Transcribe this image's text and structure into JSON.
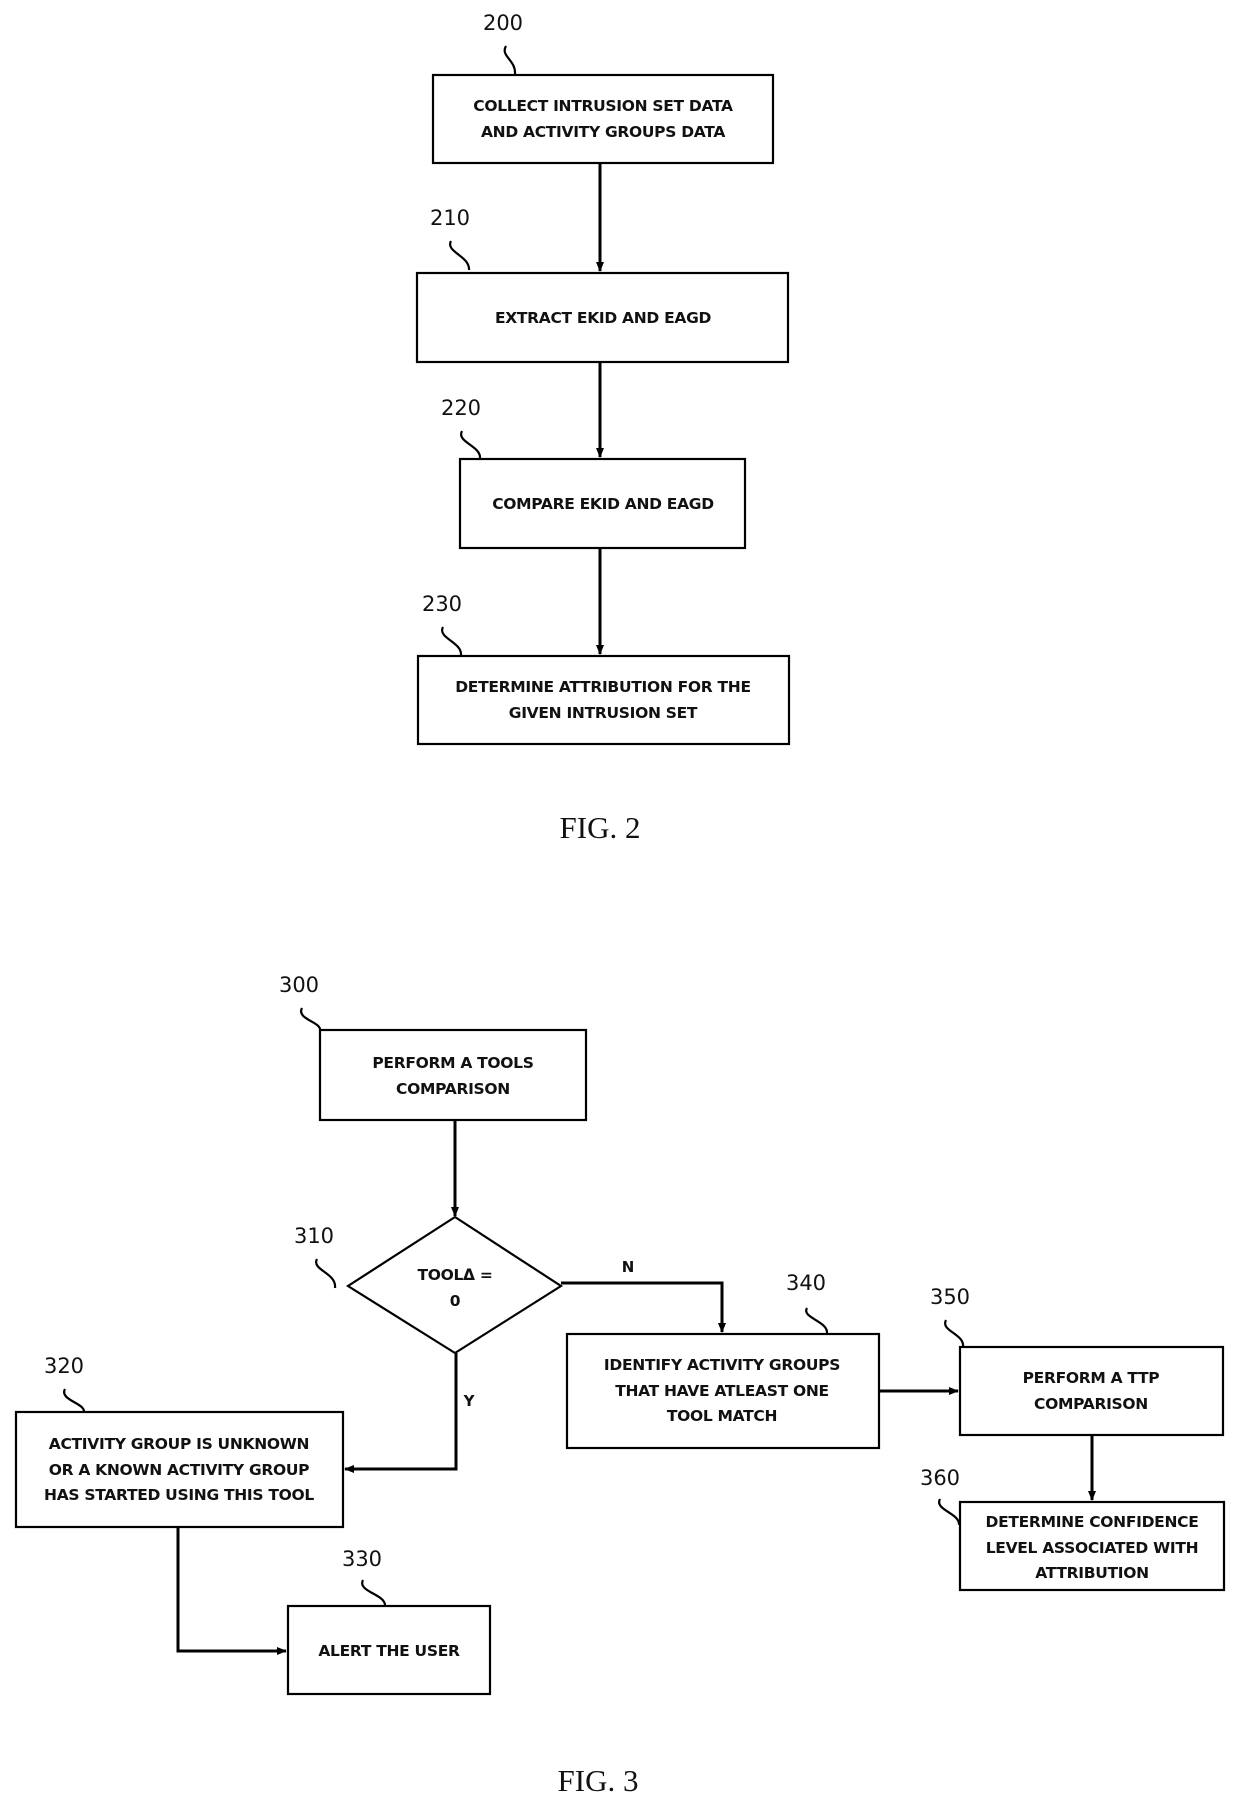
{
  "figures": [
    {
      "caption": "FIG. 2",
      "steps": [
        {
          "ref": "200",
          "lines": [
            "COLLECT INTRUSION SET DATA",
            "AND ACTIVITY GROUPS DATA"
          ]
        },
        {
          "ref": "210",
          "lines": [
            "EXTRACT EKID AND EAGD"
          ]
        },
        {
          "ref": "220",
          "lines": [
            "COMPARE EKID AND EAGD"
          ]
        },
        {
          "ref": "230",
          "lines": [
            "DETERMINE ATTRIBUTION FOR THE",
            "GIVEN INTRUSION SET"
          ]
        }
      ]
    },
    {
      "caption": "FIG. 3",
      "steps": [
        {
          "ref": "300",
          "lines": [
            "PERFORM A TOOLS",
            "COMPARISON"
          ]
        },
        {
          "ref": "310",
          "lines": [
            "TOOLΔ =",
            "0"
          ],
          "shape": "decision"
        },
        {
          "ref": "320",
          "lines": [
            "ACTIVITY GROUP  IS UNKNOWN",
            "OR  A KNOWN  ACTIVITY GROUP",
            "HAS STARTED USING THIS TOOL"
          ]
        },
        {
          "ref": "330",
          "lines": [
            "ALERT THE USER"
          ]
        },
        {
          "ref": "340",
          "lines": [
            "IDENTIFY ACTIVITY GROUPS",
            "THAT HAVE ATLEAST ONE",
            "TOOL MATCH"
          ]
        },
        {
          "ref": "350",
          "lines": [
            "PERFORM A TTP",
            "COMPARISON"
          ]
        },
        {
          "ref": "360",
          "lines": [
            "DETERMINE CONFIDENCE",
            "LEVEL ASSOCIATED WITH",
            "ATTRIBUTION"
          ]
        }
      ],
      "branch_labels": {
        "no": "N",
        "yes": "Y"
      }
    }
  ]
}
